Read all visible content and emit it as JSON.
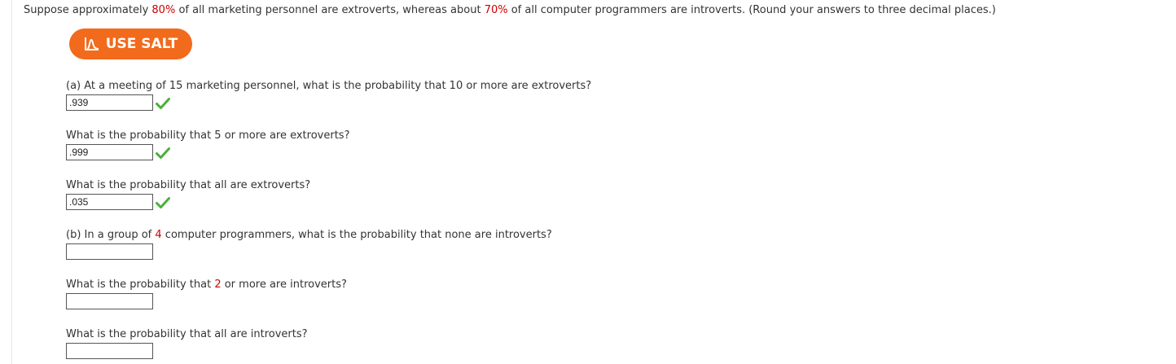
{
  "intro": {
    "text_1": "Suppose approximately ",
    "pct_extro": "80%",
    "text_2": " of all marketing personnel are extroverts, whereas about ",
    "pct_intro": "70%",
    "text_3": " of all computer programmers are introverts. (Round your answers to three decimal places.)"
  },
  "salt_button": {
    "label": "USE SALT",
    "icon": "salt-curve-icon",
    "color": "#f26a1b"
  },
  "colors": {
    "highlight": "#cc0000",
    "check": "#4caf3a"
  },
  "questions": [
    {
      "text": "(a) At a meeting of 15 marketing personnel, what is the probability that 10 or more are extroverts?",
      "answer": ".939",
      "status": "correct"
    },
    {
      "text": "What is the probability that 5 or more are extroverts?",
      "answer": ".999",
      "status": "correct"
    },
    {
      "text": "What is the probability that all are extroverts?",
      "answer": ".035",
      "status": "correct"
    },
    {
      "text_1": "(b) In a group of ",
      "number": "4",
      "text_2": " computer programmers, what is the probability that none are introverts?",
      "answer": ""
    },
    {
      "text_1": "What is the probability that ",
      "number": "2",
      "text_2": " or more are introverts?",
      "answer": ""
    },
    {
      "text": "What is the probability that all are introverts?",
      "answer": ""
    }
  ]
}
